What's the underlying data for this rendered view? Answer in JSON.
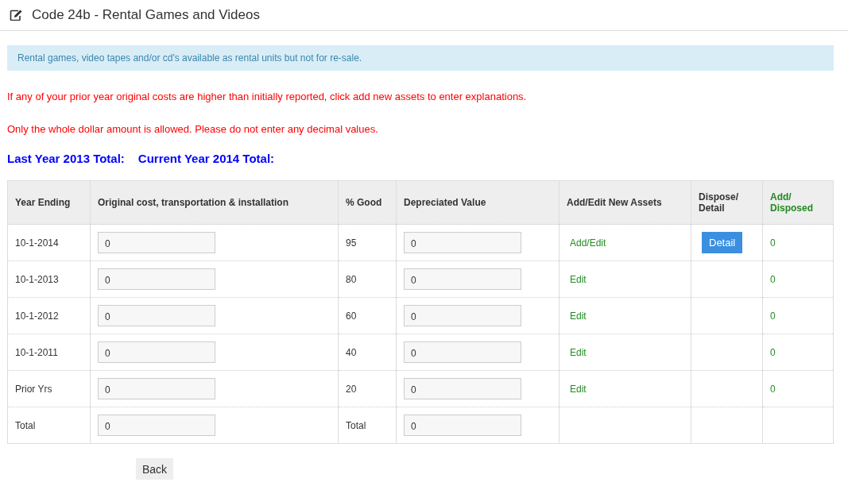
{
  "page": {
    "title": "Code 24b - Rental Games and Videos"
  },
  "info": "Rental games, video tapes and/or cd's available as rental units but not for re-sale.",
  "warnings": [
    "If any of your prior year original costs are higher than initially reported, click add new assets to enter explanations.",
    "Only the whole dollar amount is allowed. Please do not enter any decimal values."
  ],
  "totals": [
    "Last Year 2013 Total:",
    "Current Year 2014 Total:"
  ],
  "table": {
    "columns": [
      {
        "label": "Year Ending",
        "kind": "plain"
      },
      {
        "label": "Original cost, transportation & installation",
        "kind": "plain"
      },
      {
        "label": "% Good",
        "kind": "plain"
      },
      {
        "label": "Depreciated Value",
        "kind": "plain"
      },
      {
        "label": "Add/Edit New Assets",
        "kind": "plain"
      },
      {
        "label": "Dispose/ Detail",
        "kind": "plain"
      },
      {
        "label": "Add/ Disposed",
        "kind": "green"
      }
    ],
    "rows": [
      {
        "kind": "year",
        "year": "10-1-2014",
        "cost": "0",
        "good": "95",
        "value": "0",
        "action": "Add/Edit",
        "detail": "Detail",
        "disposed": "0"
      },
      {
        "kind": "year",
        "year": "10-1-2013",
        "cost": "0",
        "good": "80",
        "value": "0",
        "action": "Edit",
        "disposed": "0"
      },
      {
        "kind": "year",
        "year": "10-1-2012",
        "cost": "0",
        "good": "60",
        "value": "0",
        "action": "Edit",
        "disposed": "0"
      },
      {
        "kind": "year",
        "year": "10-1-2011",
        "cost": "0",
        "good": "40",
        "value": "0",
        "action": "Edit",
        "disposed": "0"
      },
      {
        "kind": "year",
        "year": "Prior Yrs",
        "cost": "0",
        "good": "20",
        "value": "0",
        "action": "Edit",
        "disposed": "0"
      },
      {
        "kind": "total",
        "year": "Total",
        "cost": "0",
        "good": "Total",
        "value": "0"
      }
    ]
  },
  "back_button": "Back"
}
